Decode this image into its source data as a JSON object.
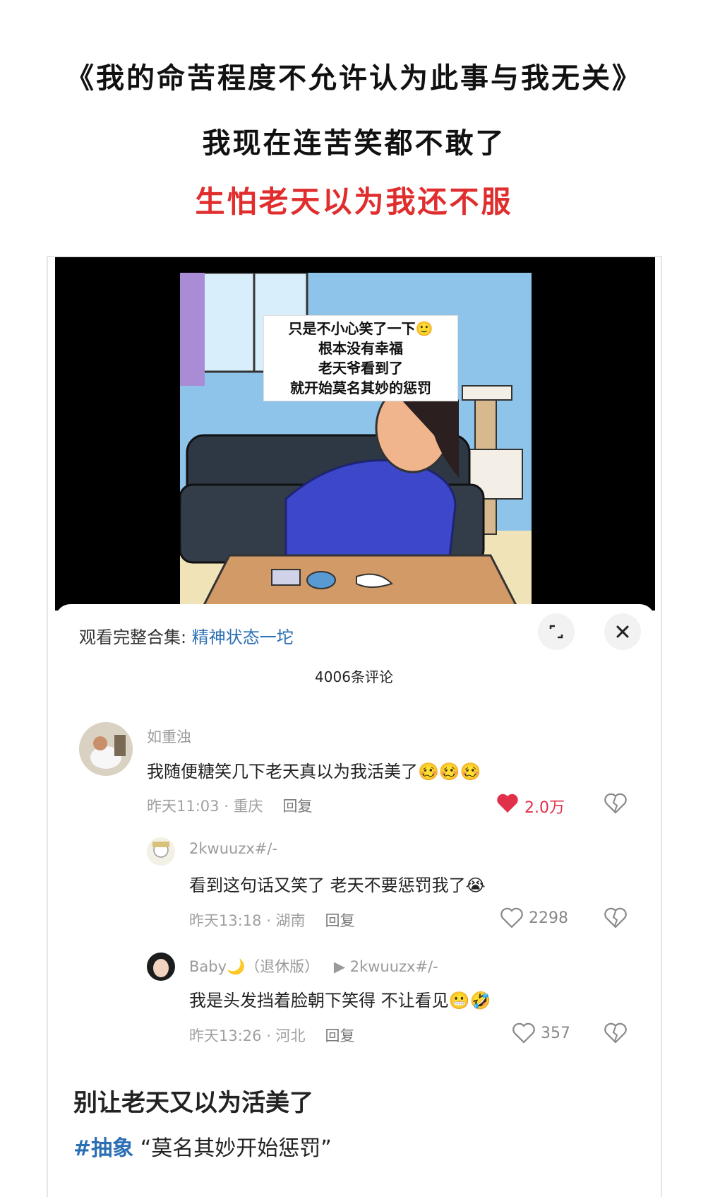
{
  "header": {
    "line1": "《我的命苦程度不允许认为此事与我无关》",
    "line2": "我现在连苦笑都不敢了",
    "line3": "生怕老天以为我还不服"
  },
  "video": {
    "caption_lines": [
      "只是不小心笑了一下🙂",
      "根本没有幸福",
      "老天爷看到了",
      "就开始莫名其妙的惩罚"
    ]
  },
  "sheet": {
    "collection_prefix": "观看完整合集:",
    "collection_name": "精神状态一坨",
    "comment_count": "4006条评论",
    "expand_icon": "expand-icon",
    "close_icon": "close-icon"
  },
  "comments": [
    {
      "user": "如重浊",
      "text": "我随便糖笑几下老天真以为我活美了",
      "emoji": "🥴🥴🥴",
      "meta": "昨天11:03 · 重庆",
      "reply": "回复",
      "likes": "2.0万"
    },
    {
      "user": "2kwuuzx#/-",
      "text": "看到这句话又笑了 老天不要惩罚我了",
      "emoji": "😭",
      "meta": "昨天13:18 · 湖南",
      "reply": "回复",
      "likes": "2298"
    },
    {
      "user": "Baby🌙（退休版）",
      "reply_to": "2kwuuzx#/-",
      "text": "我是头发挡着脸朝下笑得 不让看见",
      "emoji": "😬🤣",
      "meta": "昨天13:26 · 河北",
      "reply": "回复",
      "likes": "357"
    }
  ],
  "post": {
    "title": "别让老天又以为活美了",
    "hashtag": "#抽象",
    "quote": "“莫名其妙开始惩罚”"
  },
  "colors": {
    "accent": "#2b6fb4",
    "heart_liked": "#e0304a",
    "headline_red": "#e02d2d"
  }
}
